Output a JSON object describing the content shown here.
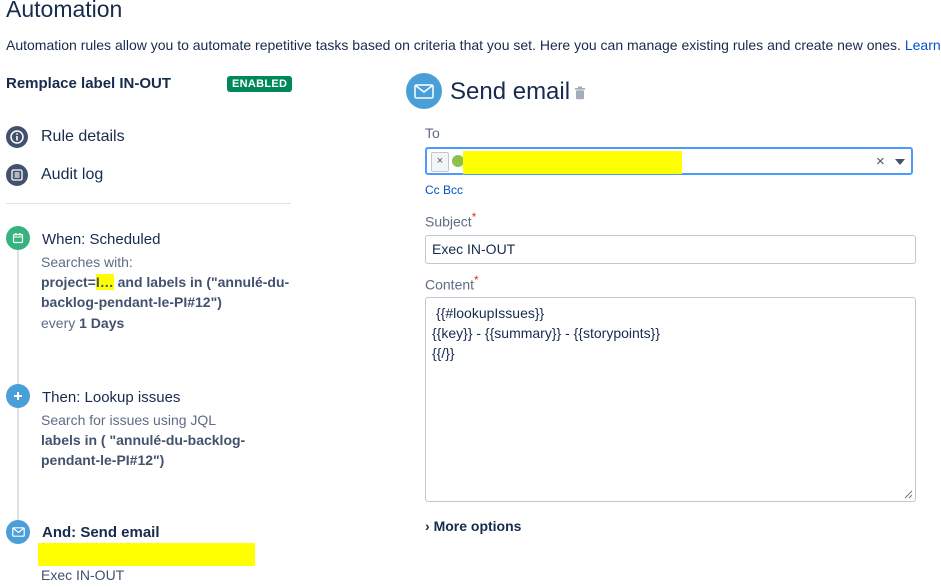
{
  "page": {
    "title": "Automation",
    "intro": "Automation rules allow you to automate repetitive tasks based on criteria that you set. Here you can manage existing rules and create new ones.",
    "learn_link": "Learn"
  },
  "rule": {
    "name": "Remplace label IN-OUT",
    "status": "ENABLED"
  },
  "nav": [
    {
      "label": "Rule details",
      "icon": "info-icon"
    },
    {
      "label": "Audit log",
      "icon": "list-icon"
    }
  ],
  "steps": {
    "when": {
      "title": "When: Scheduled",
      "sub": "Searches with:",
      "jql_prefix": "project=",
      "jql_hidden": "I…",
      "jql_rest": " and labels in (\"annulé-du-backlog-pendant-le-PI#12\")",
      "every_prefix": "every ",
      "every_value": "1 Days",
      "icon": "calendar-icon",
      "color": "#36b37e"
    },
    "then": {
      "title": "Then: Lookup issues",
      "sub": "Search for issues using JQL",
      "jql": "labels in ( \"annulé-du-backlog-pendant-le-PI#12\")",
      "icon": "plus-icon",
      "color": "#4a9fd9"
    },
    "and": {
      "title": "And: Send email",
      "subject": "Exec IN-OUT",
      "icon": "envelope-icon",
      "color": "#4a9fd9"
    }
  },
  "panel": {
    "title": "Send email",
    "to_label": "To",
    "chip_remove": "×",
    "clear": "×",
    "cc_bcc": "Cc Bcc",
    "subject_label": "Subject",
    "subject_value": "Exec IN-OUT",
    "content_label": "Content",
    "required_marker": "*",
    "content_lines": [
      "{{#lookupIssues}}",
      "{{key}} - {{summary}} - {{storypoints}}",
      "{{/}}"
    ],
    "more_options": "More options",
    "more_options_chevron": "›"
  },
  "colors": {
    "accent": "#0052cc",
    "enabled": "#00875a",
    "redaction": "#ffff00",
    "focus": "#4c9aff"
  }
}
